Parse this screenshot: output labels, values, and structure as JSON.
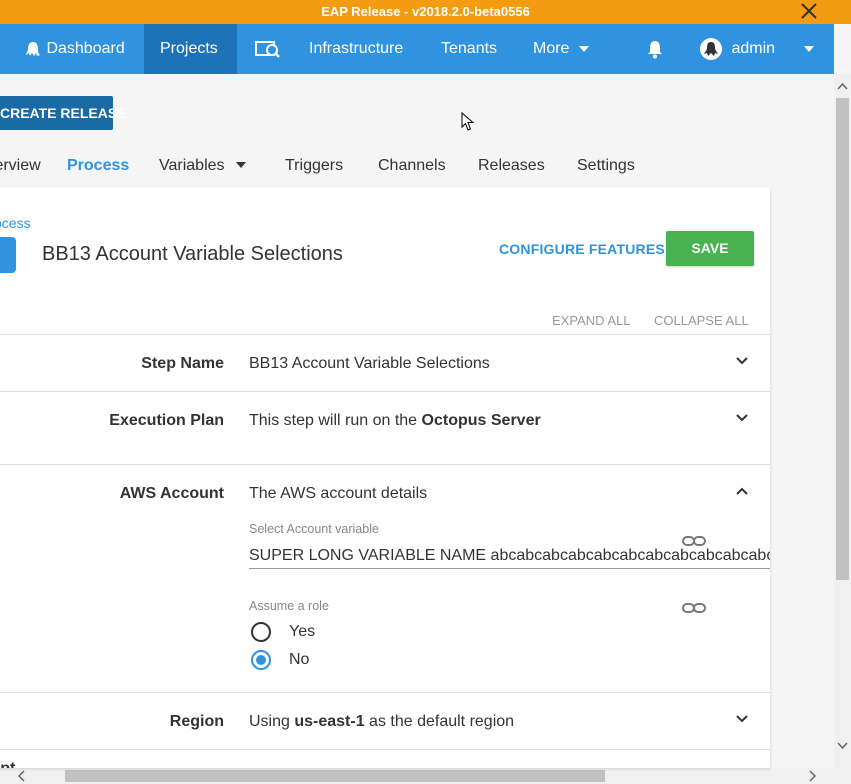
{
  "banner": {
    "text": "EAP Release - v2018.2.0-beta0556"
  },
  "nav": {
    "dashboard": "Dashboard",
    "projects": "Projects",
    "infrastructure": "Infrastructure",
    "tenants": "Tenants",
    "more": "More",
    "user": "admin"
  },
  "toolbar": {
    "create_release": "CREATE RELEASE"
  },
  "tabs": {
    "overview": "Overview",
    "process": "Process",
    "variables": "Variables",
    "triggers": "Triggers",
    "channels": "Channels",
    "releases": "Releases",
    "settings": "Settings"
  },
  "step": {
    "breadcrumb": "Process",
    "title": "BB13 Account Variable Selections",
    "configure_features": "CONFIGURE FEATURES",
    "save": "SAVE",
    "expand_all": "EXPAND ALL",
    "collapse_all": "COLLAPSE ALL"
  },
  "sections": {
    "step_name": {
      "label": "Step Name",
      "value": "BB13 Account Variable Selections"
    },
    "execution_plan": {
      "label": "Execution Plan",
      "value_prefix": "This step will run on the ",
      "value_bold": "Octopus Server"
    },
    "aws_account": {
      "label": "AWS Account",
      "summary": "The AWS account details",
      "select_label": "Select Account variable",
      "select_value": "SUPER LONG VARIABLE NAME abcabcabcabcabcabcabcabcabcabcabcabcabcabca",
      "assume_label": "Assume a role",
      "options": [
        "Yes",
        "No"
      ],
      "selected": "No"
    },
    "region": {
      "label": "Region",
      "value_prefix": "Using ",
      "value_bold": "us-east-1",
      "value_suffix": " as the default region"
    },
    "next_partial": "Script"
  },
  "colors": {
    "nav": "#2f93e0",
    "nav_active": "#1e73b8",
    "banner": "#f39c12",
    "save": "#48b350",
    "link": "#2f93e0"
  }
}
